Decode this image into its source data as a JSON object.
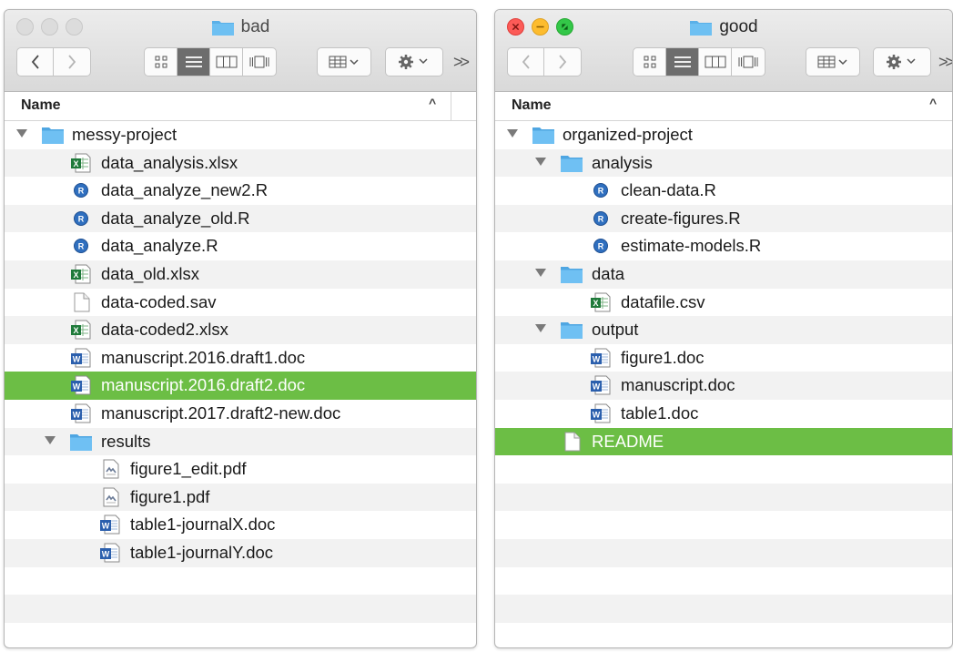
{
  "windows": [
    {
      "title": "bad",
      "column_header": "Name",
      "rows": [
        {
          "name": "messy-project",
          "icon": "folder",
          "depth": 0,
          "disclosure": "expanded"
        },
        {
          "name": "data_analysis.xlsx",
          "icon": "excel",
          "depth": 1
        },
        {
          "name": "data_analyze_new2.R",
          "icon": "r-script",
          "depth": 1
        },
        {
          "name": "data_analyze_old.R",
          "icon": "r-script",
          "depth": 1
        },
        {
          "name": "data_analyze.R",
          "icon": "r-script",
          "depth": 1
        },
        {
          "name": "data_old.xlsx",
          "icon": "excel",
          "depth": 1
        },
        {
          "name": "data-coded.sav",
          "icon": "blank-file",
          "depth": 1
        },
        {
          "name": "data-coded2.xlsx",
          "icon": "excel",
          "depth": 1
        },
        {
          "name": "manuscript.2016.draft1.doc",
          "icon": "word",
          "depth": 1
        },
        {
          "name": "manuscript.2016.draft2.doc",
          "icon": "word",
          "depth": 1,
          "selected": true
        },
        {
          "name": "manuscript.2017.draft2-new.doc",
          "icon": "word",
          "depth": 1
        },
        {
          "name": "results",
          "icon": "folder",
          "depth": 1,
          "disclosure": "expanded"
        },
        {
          "name": "figure1_edit.pdf",
          "icon": "pdf",
          "depth": 2
        },
        {
          "name": "figure1.pdf",
          "icon": "pdf",
          "depth": 2
        },
        {
          "name": "table1-journalX.doc",
          "icon": "word",
          "depth": 2
        },
        {
          "name": "table1-journalY.doc",
          "icon": "word",
          "depth": 2
        },
        {
          "name": "",
          "icon": "",
          "depth": 0
        },
        {
          "name": "",
          "icon": "",
          "depth": 0
        },
        {
          "name": "",
          "icon": "",
          "depth": 0
        },
        {
          "name": "",
          "icon": "",
          "depth": 0
        }
      ]
    },
    {
      "title": "good",
      "column_header": "Name",
      "rows": [
        {
          "name": "organized-project",
          "icon": "folder",
          "depth": 0,
          "disclosure": "expanded"
        },
        {
          "name": "analysis",
          "icon": "folder",
          "depth": 1,
          "disclosure": "expanded"
        },
        {
          "name": "clean-data.R",
          "icon": "r-script",
          "depth": 2
        },
        {
          "name": "create-figures.R",
          "icon": "r-script",
          "depth": 2
        },
        {
          "name": "estimate-models.R",
          "icon": "r-script",
          "depth": 2
        },
        {
          "name": "data",
          "icon": "folder",
          "depth": 1,
          "disclosure": "expanded"
        },
        {
          "name": "datafile.csv",
          "icon": "excel-csv",
          "depth": 2
        },
        {
          "name": "output",
          "icon": "folder",
          "depth": 1,
          "disclosure": "expanded"
        },
        {
          "name": "figure1.doc",
          "icon": "word",
          "depth": 2
        },
        {
          "name": "manuscript.doc",
          "icon": "word",
          "depth": 2
        },
        {
          "name": "table1.doc",
          "icon": "word",
          "depth": 2
        },
        {
          "name": "README",
          "icon": "blank-file",
          "depth": 1,
          "selected": true
        },
        {
          "name": "",
          "icon": "",
          "depth": 0
        },
        {
          "name": "",
          "icon": "",
          "depth": 0
        },
        {
          "name": "",
          "icon": "",
          "depth": 0
        },
        {
          "name": "",
          "icon": "",
          "depth": 0
        },
        {
          "name": "",
          "icon": "",
          "depth": 0
        },
        {
          "name": "",
          "icon": "",
          "depth": 0
        },
        {
          "name": "",
          "icon": "",
          "depth": 0
        },
        {
          "name": "",
          "icon": "",
          "depth": 0
        }
      ]
    }
  ],
  "colors": {
    "selection": "#6cbe45",
    "folder": "#5ab0e8",
    "r_icon": "#2f6fbf",
    "excel": "#1f7a3a",
    "word": "#2b5fad"
  }
}
